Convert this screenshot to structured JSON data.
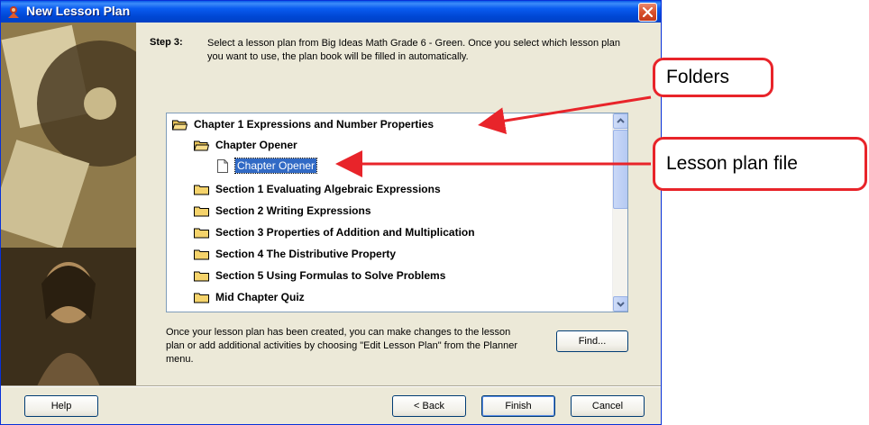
{
  "window": {
    "title": "New Lesson Plan"
  },
  "step": {
    "label": "Step 3:",
    "text": "Select a lesson plan from Big Ideas Math Grade 6 - Green.  Once you select which lesson plan you want to use, the plan book will be filled in automatically."
  },
  "tree": {
    "items": [
      {
        "label": "Chapter 1 Expressions and Number Properties",
        "type": "open-folder",
        "level": 0
      },
      {
        "label": "Chapter Opener",
        "type": "open-folder",
        "level": 1
      },
      {
        "label": "Chapter Opener",
        "type": "file",
        "level": 2,
        "selected": true
      },
      {
        "label": "Section 1 Evaluating Algebraic Expressions",
        "type": "folder",
        "level": 1
      },
      {
        "label": "Section 2 Writing Expressions",
        "type": "folder",
        "level": 1
      },
      {
        "label": "Section 3 Properties of Addition and Multiplication",
        "type": "folder",
        "level": 1
      },
      {
        "label": "Section 4 The Distributive Property",
        "type": "folder",
        "level": 1
      },
      {
        "label": "Section 5 Using Formulas to Solve Problems",
        "type": "folder",
        "level": 1
      },
      {
        "label": "Mid Chapter Quiz",
        "type": "folder",
        "level": 1
      }
    ]
  },
  "info": {
    "text": "Once your lesson plan has been created, you can make changes to the lesson plan or add additional activities by choosing \"Edit Lesson Plan\" from the Planner menu."
  },
  "buttons": {
    "find": "Find...",
    "help": "Help",
    "back": "< Back",
    "finish": "Finish",
    "cancel": "Cancel"
  },
  "callouts": {
    "folders": "Folders",
    "lesson_file": "Lesson plan file"
  },
  "colors": {
    "callout_border": "#e8242a",
    "selection": "#316ac5",
    "titlebar": "#0a5cf0",
    "folder": "#f5d36b"
  },
  "icons": {
    "title": "lesson-plan-icon",
    "close": "close-icon",
    "folder": "folder-icon",
    "open_folder": "open-folder-icon",
    "file": "document-icon"
  }
}
